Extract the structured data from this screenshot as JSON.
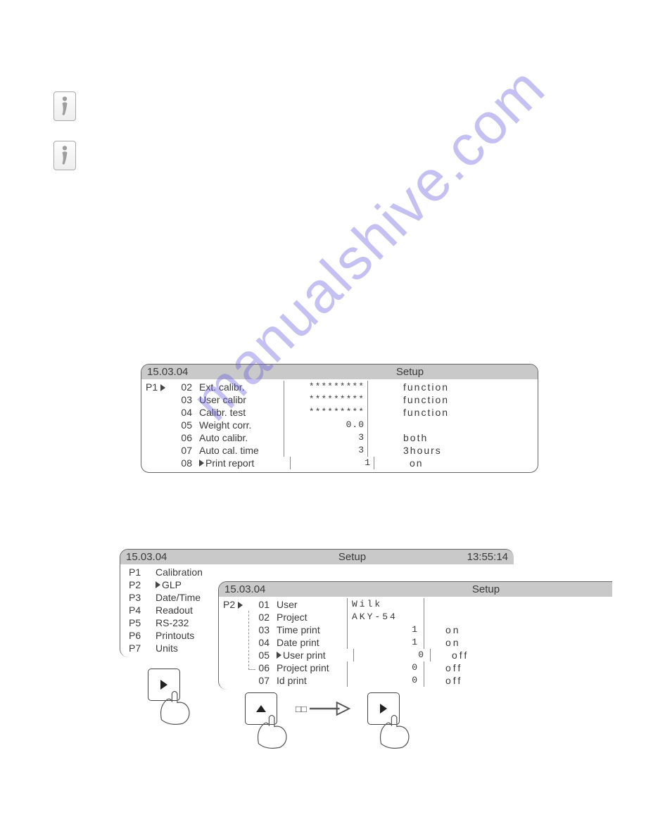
{
  "watermark_text": "manualshive.com",
  "panel_p1": {
    "date": "15.03.04",
    "title": "Setup",
    "group": "P1",
    "rows": [
      {
        "num": "02",
        "name": "Ext. calibr.",
        "value": "*********",
        "desc": "function",
        "cursor": true,
        "vright": true
      },
      {
        "num": "03",
        "name": "User calibr",
        "value": "*********",
        "desc": "function",
        "cursor": false,
        "vright": true
      },
      {
        "num": "04",
        "name": "Calibr. test",
        "value": "*********",
        "desc": "function",
        "cursor": false,
        "vright": true
      },
      {
        "num": "05",
        "name": "Weight corr.",
        "value": "0.0",
        "desc": "",
        "cursor": false,
        "vright": true
      },
      {
        "num": "06",
        "name": "Auto calibr.",
        "value": "3",
        "desc": "both",
        "cursor": false,
        "vright": true
      },
      {
        "num": "07",
        "name": "Auto cal. time",
        "value": "3",
        "desc": "3hours",
        "cursor": false,
        "vright": true
      },
      {
        "num": "08",
        "name": "Print report",
        "value": "1",
        "desc": "on",
        "cursor": true,
        "pre": true,
        "vright": true
      }
    ]
  },
  "panel_plist": {
    "date": "15.03.04",
    "title": "Setup",
    "time": "13:55:14",
    "items": [
      {
        "id": "P1",
        "name": "Calibration",
        "cursor": false
      },
      {
        "id": "P2",
        "name": "GLP",
        "cursor": true
      },
      {
        "id": "P3",
        "name": "Date/Time",
        "cursor": false
      },
      {
        "id": "P4",
        "name": "Readout",
        "cursor": false
      },
      {
        "id": "P5",
        "name": "RS-232",
        "cursor": false
      },
      {
        "id": "P6",
        "name": "Printouts",
        "cursor": false
      },
      {
        "id": "P7",
        "name": "Units",
        "cursor": false
      }
    ]
  },
  "panel_p2": {
    "date": "15.03.04",
    "title": "Setup",
    "group": "P2",
    "rows": [
      {
        "num": "01",
        "name": "User",
        "value": "Wilk",
        "desc": "",
        "cursor": true,
        "vright": false
      },
      {
        "num": "02",
        "name": "Project",
        "value": "AKY-54",
        "desc": "",
        "cursor": false,
        "vright": false
      },
      {
        "num": "03",
        "name": "Time print",
        "value": "1",
        "desc": "on",
        "cursor": false,
        "vright": true
      },
      {
        "num": "04",
        "name": "Date print",
        "value": "1",
        "desc": "on",
        "cursor": false,
        "vright": true
      },
      {
        "num": "05",
        "name": "User print",
        "value": "0",
        "desc": "off",
        "cursor": true,
        "pre": true,
        "vright": true
      },
      {
        "num": "06",
        "name": "Project print",
        "value": "0",
        "desc": "off",
        "cursor": false,
        "vright": true
      },
      {
        "num": "07",
        "name": "Id print",
        "value": "0",
        "desc": "off",
        "cursor": false,
        "vright": true
      }
    ]
  },
  "arrow_label": "□□"
}
